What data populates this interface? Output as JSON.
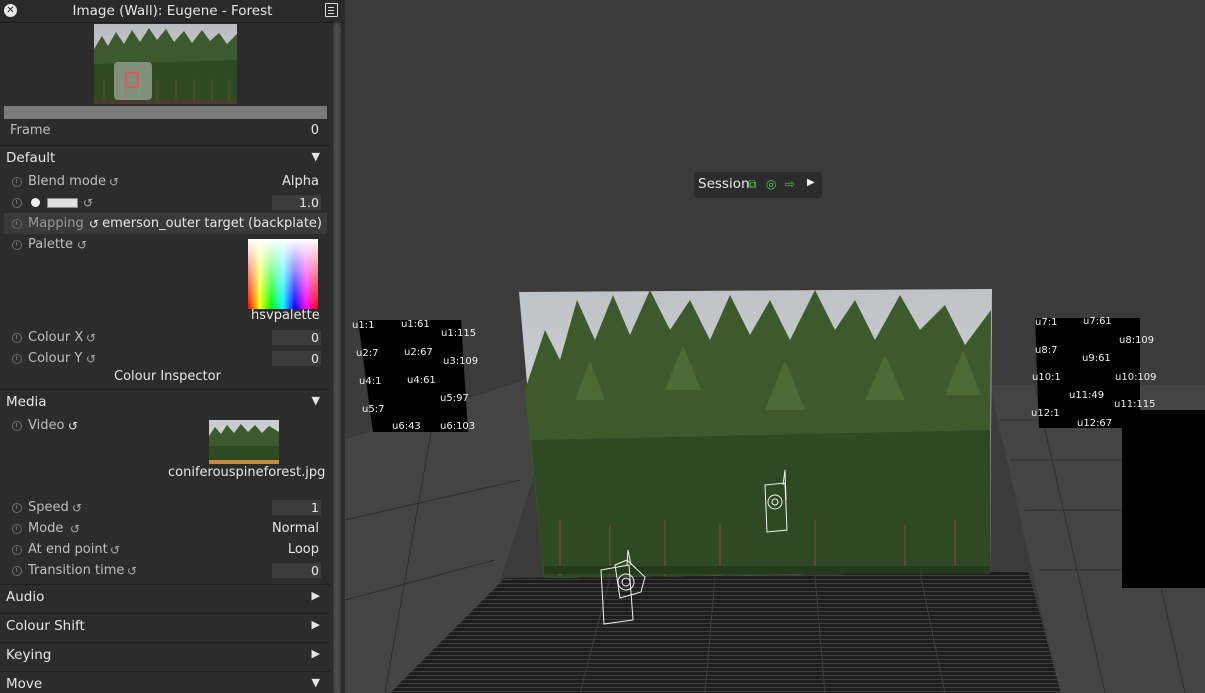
{
  "panel": {
    "title": "Image (Wall): Eugene - Forest",
    "close_icon": "close-icon",
    "menu_icon": "panel-menu-icon"
  },
  "frame": {
    "label": "Frame",
    "value": "0"
  },
  "sections": {
    "default": {
      "label": "Default",
      "state": "expanded"
    },
    "media": {
      "label": "Media",
      "state": "expanded"
    },
    "audio": {
      "label": "Audio",
      "state": "collapsed"
    },
    "colour_shift": {
      "label": "Colour Shift",
      "state": "collapsed"
    },
    "keying": {
      "label": "Keying",
      "state": "collapsed"
    },
    "move": {
      "label": "Move",
      "state": "expanded"
    }
  },
  "default_props": {
    "blend_mode": {
      "label": "Blend mode",
      "value": "Alpha"
    },
    "opacity": {
      "value": "1.0"
    },
    "mapping": {
      "label": "Mapping",
      "value": "emerson_outer target (backplate)"
    },
    "palette": {
      "label": "Palette",
      "value": "hsvpalette"
    },
    "colour_x": {
      "label": "Colour X",
      "value": "0"
    },
    "colour_y": {
      "label": "Colour Y",
      "value": "0"
    },
    "colour_inspector": "Colour Inspector"
  },
  "media_props": {
    "video": {
      "label": "Video",
      "value": "coniferouspineforest.jpg"
    },
    "speed": {
      "label": "Speed",
      "value": "1"
    },
    "mode": {
      "label": "Mode",
      "value": "Normal"
    },
    "at_end_point": {
      "label": "At end point",
      "value": "Loop"
    },
    "transition_time": {
      "label": "Transition time",
      "value": "0"
    }
  },
  "session": {
    "label": "Session"
  },
  "led_labels_left": [
    "u1:1",
    "u1:61",
    "u1:115",
    "u2:7",
    "u2:67",
    "u3:109",
    "u4:1",
    "u4:61",
    "u5:97",
    "u5:7",
    "u6:43",
    "u6:103"
  ],
  "led_labels_right": [
    "u7:1",
    "u7:61",
    "u8:109",
    "u8:7",
    "u9:61",
    "u10:1",
    "u10:109",
    "u11:49",
    "u11:115",
    "u12:1",
    "u12:67"
  ]
}
